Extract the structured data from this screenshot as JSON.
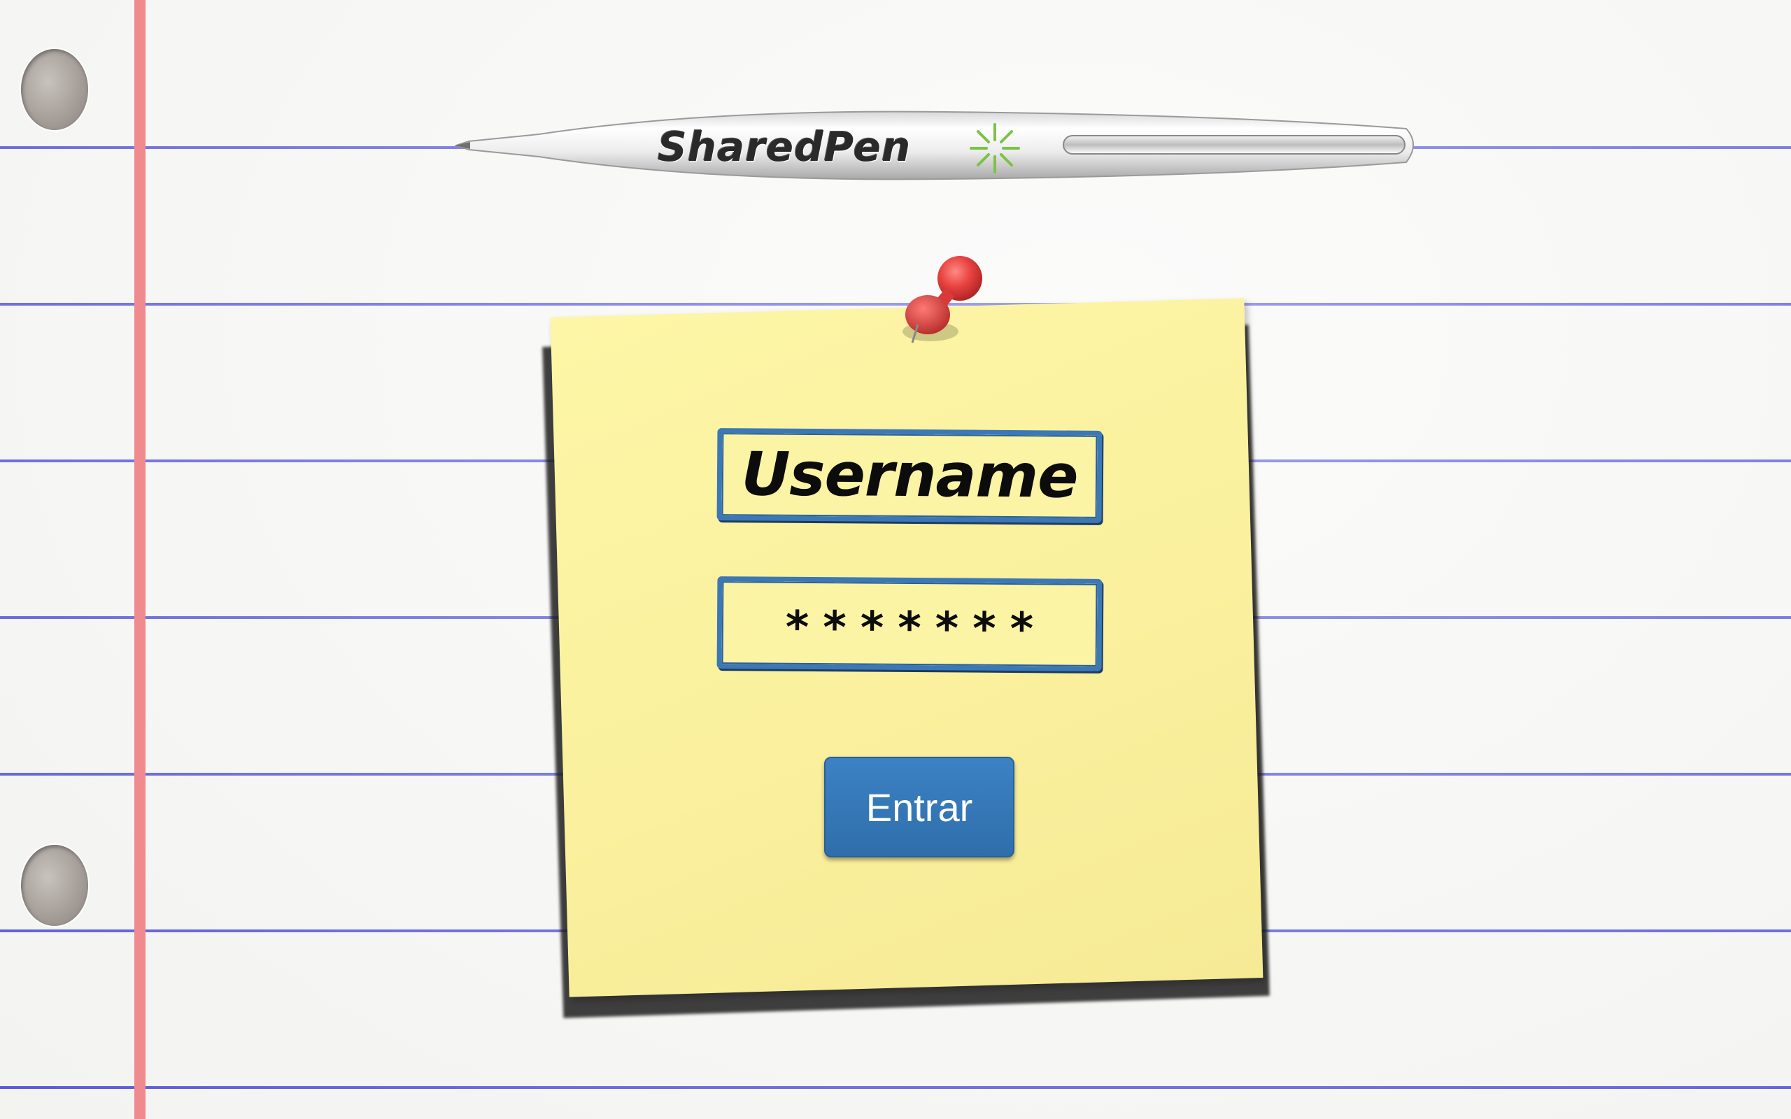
{
  "brand": {
    "name": "SharedPen",
    "logo_icon": "asterisk-burst-icon",
    "logo_color": "#7cc245"
  },
  "login_form": {
    "username_placeholder": "Username",
    "password_mask": "*******",
    "submit_label": "Entrar"
  },
  "colors": {
    "rule_line": "#1a1ad8",
    "margin_line": "#ef8a8e",
    "sticky_note": "#fbf2a0",
    "field_border": "#3b78b5",
    "button": "#3377bb",
    "pushpin": "#e8413f"
  }
}
